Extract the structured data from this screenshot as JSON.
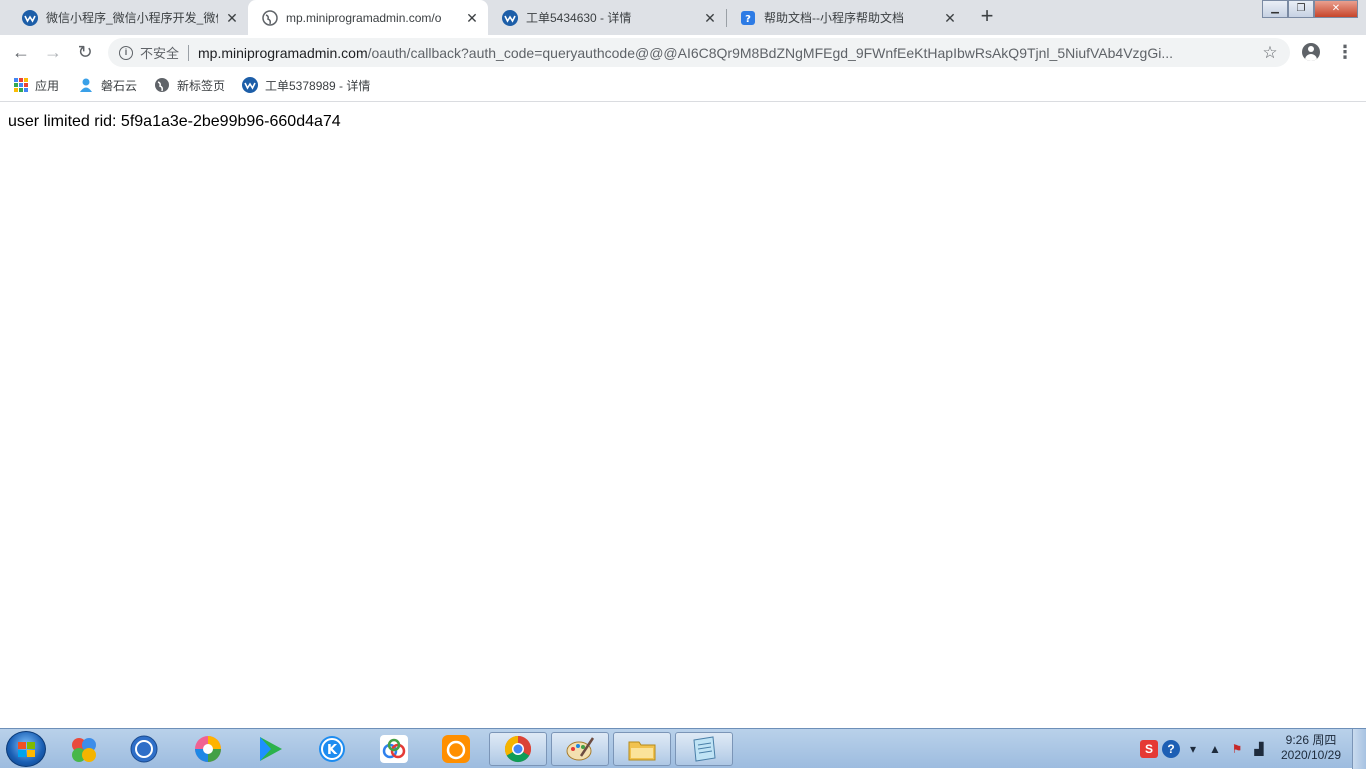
{
  "tabs": [
    {
      "title": "微信小程序_微信小程序开发_微信",
      "close": "✕",
      "icon": "wechat-mp-icon"
    },
    {
      "title": "mp.miniprogramadmin.com/o",
      "close": "✕",
      "icon": "globe-icon"
    },
    {
      "title": "工单5434630 - 详情",
      "close": "✕",
      "icon": "wechat-mp-icon"
    },
    {
      "title": "帮助文档--小程序帮助文档",
      "close": "✕",
      "icon": "help-doc-icon"
    }
  ],
  "new_tab": "+",
  "window_controls": {
    "minimize": "▁",
    "maximize": "❐",
    "close": "✕"
  },
  "toolbar": {
    "back": "←",
    "forward": "→",
    "reload": "↻",
    "security_label": "不安全",
    "url_host": "mp.miniprogramadmin.com",
    "url_rest": "/oauth/callback?auth_code=queryauthcode@@@AI6C8Qr9M8BdZNgMFEgd_9FWnfEeKtHapIbwRsAkQ9Tjnl_5NiufVAb4VzgGi...",
    "star": "☆",
    "menu": "⋮"
  },
  "bookmarks": [
    {
      "label": "应用",
      "icon": "apps-grid-icon"
    },
    {
      "label": "磐石云",
      "icon": "user-icon"
    },
    {
      "label": "新标签页",
      "icon": "globe-icon"
    },
    {
      "label": "工单5378989 - 详情",
      "icon": "wechat-mp-icon"
    }
  ],
  "page": {
    "message": "user limited rid: 5f9a1a3e-2be99b96-660d4a74"
  },
  "taskbar": {
    "clock_time": "9:26 周四",
    "clock_date": "2020/10/29",
    "pinned": [
      "windows-start-icon",
      "color-balls-icon",
      "sogou-browser-icon",
      "photo-viewer-icon",
      "video-player-icon",
      "kugou-music-icon",
      "baidu-netdisk-icon",
      "uc-browser-icon",
      "chrome-icon",
      "paint-icon",
      "file-explorer-icon",
      "notepad-icon"
    ]
  },
  "colors": {
    "tabstrip_bg": "#dee1e6",
    "omnibox_bg": "#f1f3f4",
    "taskbar_bg": "#b9d1ea"
  }
}
